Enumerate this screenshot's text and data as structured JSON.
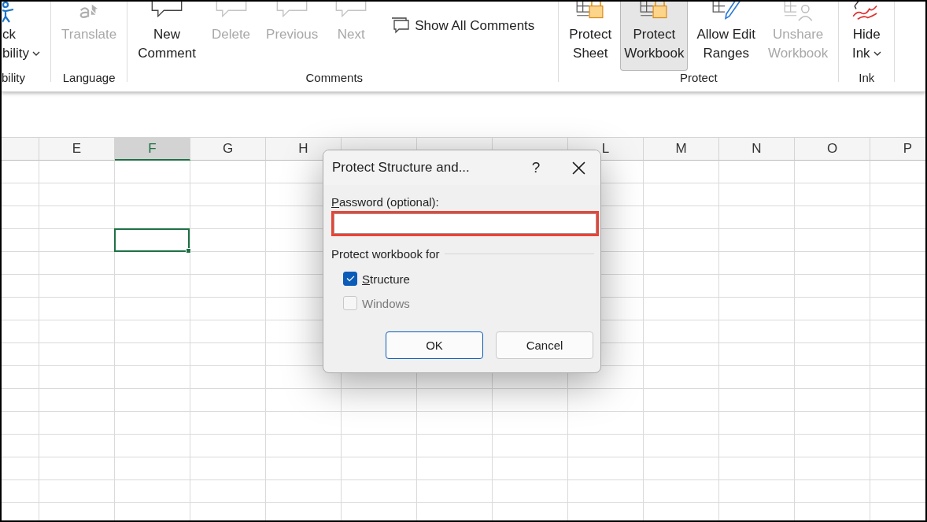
{
  "ribbon": {
    "groups": [
      {
        "label": "bility",
        "buttons": [
          {
            "lines": [
              "ck",
              "bility"
            ],
            "disabled": false,
            "selected": false,
            "dropdown": true
          }
        ]
      },
      {
        "label": "Language",
        "buttons": [
          {
            "lines": [
              "Translate"
            ],
            "disabled": true,
            "selected": false,
            "dropdown": false
          }
        ]
      },
      {
        "label": "Comments",
        "buttons": [
          {
            "lines": [
              "New",
              "Comment"
            ],
            "disabled": false,
            "selected": false,
            "dropdown": false
          },
          {
            "lines": [
              "Delete"
            ],
            "disabled": true,
            "selected": false,
            "dropdown": false
          },
          {
            "lines": [
              "Previous"
            ],
            "disabled": true,
            "selected": false,
            "dropdown": false
          },
          {
            "lines": [
              "Next"
            ],
            "disabled": true,
            "selected": false,
            "dropdown": false
          },
          {
            "kind": "small",
            "lines": [
              "Show All Comments"
            ],
            "disabled": false,
            "selected": false,
            "dropdown": false
          }
        ]
      },
      {
        "label": "Protect",
        "buttons": [
          {
            "lines": [
              "Protect",
              "Sheet"
            ],
            "disabled": false,
            "selected": false,
            "dropdown": false
          },
          {
            "lines": [
              "Protect",
              "Workbook"
            ],
            "disabled": false,
            "selected": true,
            "dropdown": false
          },
          {
            "lines": [
              "Allow Edit",
              "Ranges"
            ],
            "disabled": false,
            "selected": false,
            "dropdown": false
          },
          {
            "lines": [
              "Unshare",
              "Workbook"
            ],
            "disabled": true,
            "selected": false,
            "dropdown": false
          }
        ]
      },
      {
        "label": "Ink",
        "buttons": [
          {
            "lines": [
              "Hide",
              "Ink"
            ],
            "disabled": false,
            "selected": false,
            "dropdown": true
          }
        ]
      }
    ]
  },
  "sheet": {
    "columns": [
      {
        "selected": false
      },
      {
        "label": "E",
        "selected": false
      },
      {
        "label": "F",
        "selected": true
      },
      {
        "label": "G",
        "selected": false
      },
      {
        "label": "H",
        "selected": false
      },
      {
        "selected": false
      },
      {
        "selected": false
      },
      {
        "selected": false
      },
      {
        "label": "L",
        "selected": false
      },
      {
        "label": "M",
        "selected": false
      },
      {
        "label": "N",
        "selected": false
      },
      {
        "label": "O",
        "selected": false
      },
      {
        "label": "P",
        "selected": false
      }
    ],
    "rows": [
      {
        "selected": false
      },
      {
        "selected": false
      },
      {
        "selected": false
      },
      {
        "selected": true
      },
      {
        "selected": false
      }
    ]
  },
  "dialog": {
    "title": "Protect Structure and...",
    "help": "?",
    "password": {
      "label": "Password (optional):",
      "access_key": true,
      "highlighted": true
    },
    "section": "Protect workbook for",
    "options": [
      {
        "label": "Structure",
        "checked": true,
        "disabled": false,
        "access_key": true
      },
      {
        "label": "Windows",
        "checked": false,
        "disabled": true,
        "access_key": false
      }
    ],
    "buttons": [
      {
        "label": "OK",
        "default": true
      },
      {
        "label": "Cancel",
        "default": false
      }
    ]
  }
}
